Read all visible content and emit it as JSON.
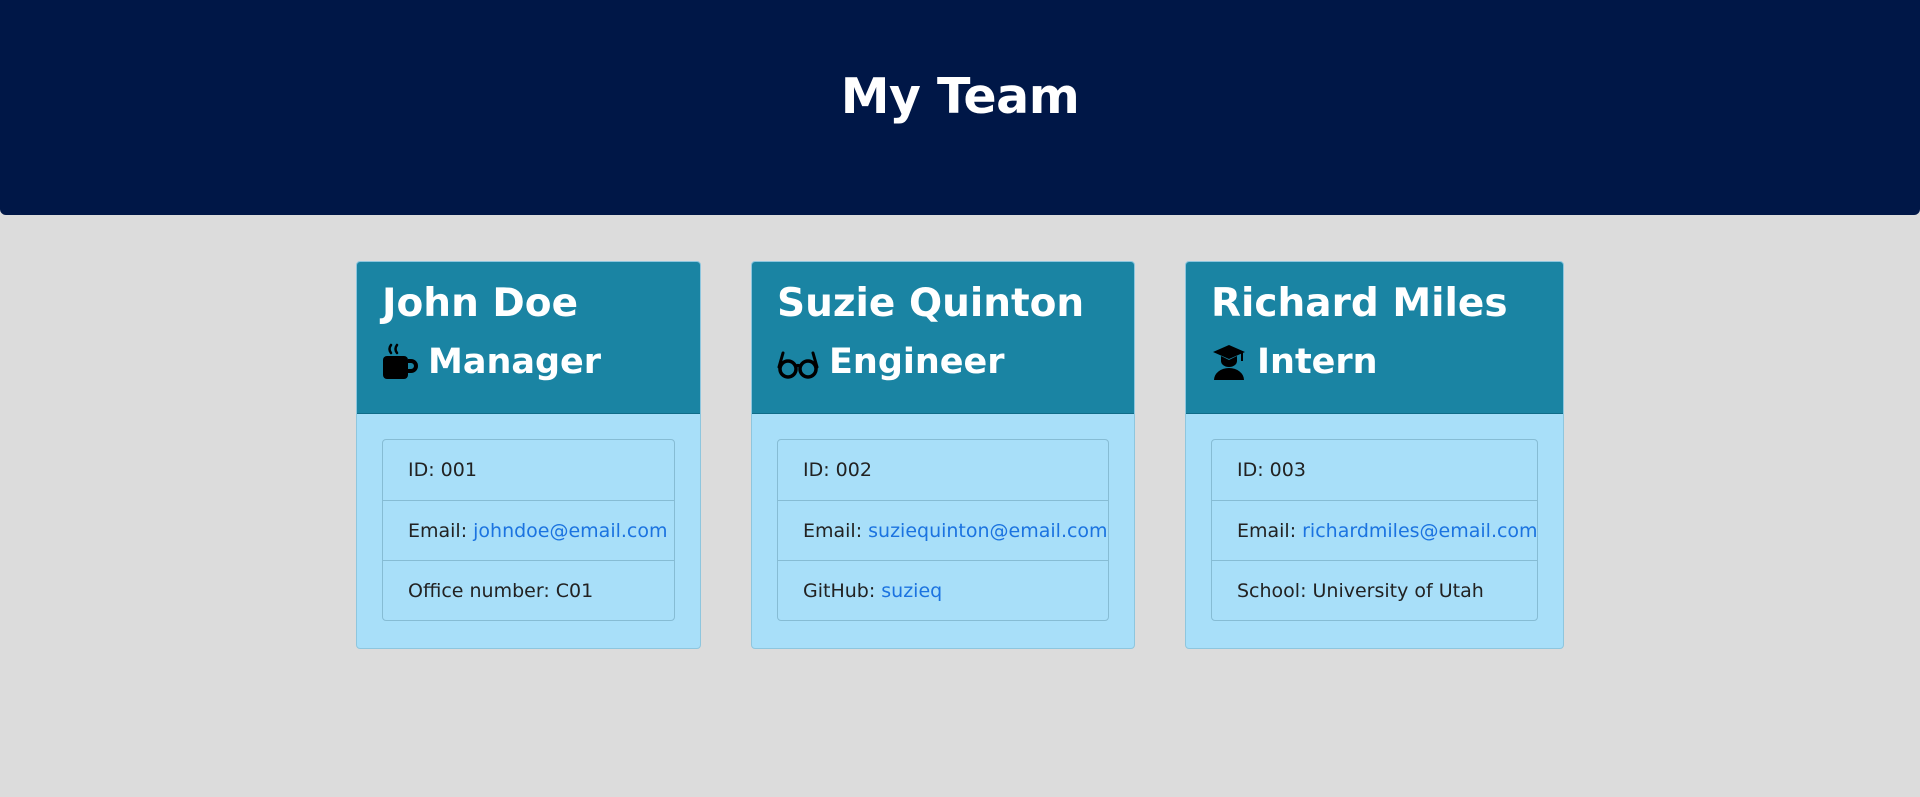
{
  "header": {
    "title": "My Team"
  },
  "cards": [
    {
      "name": "John Doe",
      "role": "Manager",
      "role_icon": "coffee-mug-icon",
      "id_label": "ID: 001",
      "email_label": "Email:",
      "email": "johndoe@email.com",
      "extra_label": "Office number: C01"
    },
    {
      "name": "Suzie Quinton",
      "role": "Engineer",
      "role_icon": "glasses-icon",
      "id_label": "ID: 002",
      "email_label": "Email:",
      "email": "suziequinton@email.com",
      "extra_label": "GitHub:",
      "extra_link": "suzieq"
    },
    {
      "name": "Richard Miles",
      "role": "Intern",
      "role_icon": "graduate-icon",
      "id_label": "ID: 003",
      "email_label": "Email:",
      "email": "richardmiles@email.com",
      "extra_label": "School: University of Utah"
    }
  ],
  "colors": {
    "header_bg": "#001747",
    "page_bg": "#dcdcdc",
    "card_head_bg": "#1a84a3",
    "card_body_bg": "#a8dff9",
    "link": "#1b73e0"
  }
}
